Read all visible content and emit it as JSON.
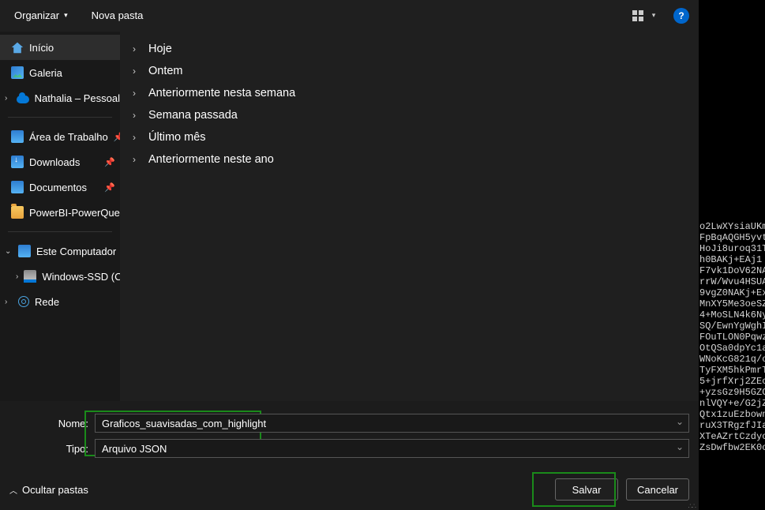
{
  "toolbar": {
    "organize": "Organizar",
    "new_folder": "Nova pasta",
    "help": "?"
  },
  "sidebar": {
    "home": "Início",
    "gallery": "Galeria",
    "personal": "Nathalia – Pessoal",
    "desktop": "Área de Trabalho",
    "downloads": "Downloads",
    "documents": "Documentos",
    "folder1": "PowerBI-PowerQue",
    "this_pc": "Este Computador",
    "drive": "Windows-SSD (C:",
    "network": "Rede"
  },
  "groups": [
    "Hoje",
    "Ontem",
    "Anteriormente nesta semana",
    "Semana passada",
    "Último mês",
    "Anteriormente neste ano"
  ],
  "footer": {
    "name_label": "Nome:",
    "name_value": "Graficos_suavisadas_com_highlight",
    "type_label": "Tipo:",
    "type_value": "Arquivo JSON",
    "hide_folders": "Ocultar pastas",
    "save": "Salvar",
    "cancel": "Cancelar"
  },
  "bgtext": "o2LwXYsiaUKm\nFpBqAQGH5yvt\nHoJi8uroq31T\nh0BAKj+EAj1\nF7vk1DoV62NA\nrrW/Wvu4HSUA\n9vgZ0NAKj+Ex\nMnXY5Me3oeSZ\n4+MoSLN4k6Ny\nSQ/EwnYgWghI\nFOuTLON0Pqwz\nOtQSa0dpYc1a\nWNoKcG821q/o\nTyFXM5hkPmrT\n5+jrfXrj2ZEc\n+yzsGz9H5GZC\nnlVQY+e/G2jZ\nQtx1zuEzbown\nruX3TRgzfJIa\nXTeAZrtCzdyo\nZsDwfbw2EK0o"
}
